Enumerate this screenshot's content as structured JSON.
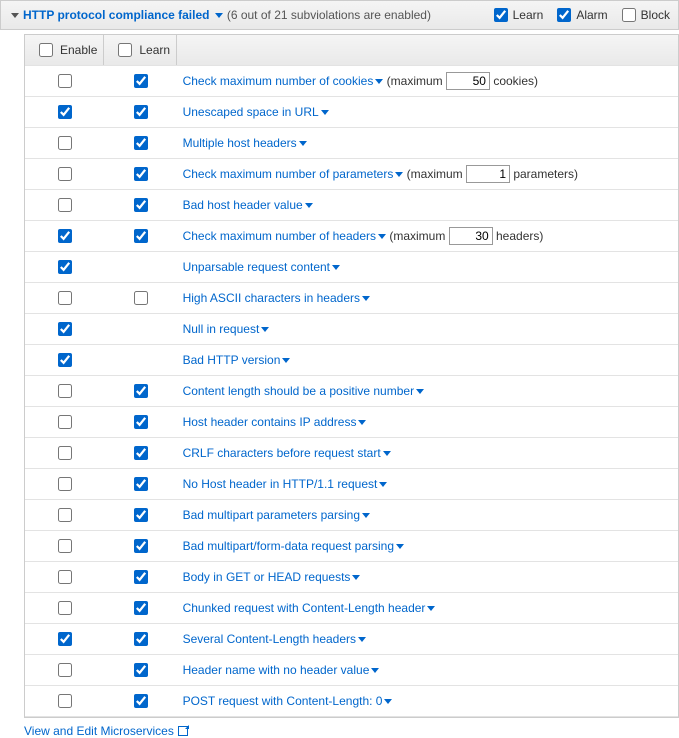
{
  "header": {
    "title": "HTTP protocol compliance failed",
    "subtitle": "(6 out of 21 subviolations are enabled)",
    "controls": {
      "learn": {
        "label": "Learn",
        "checked": true
      },
      "alarm": {
        "label": "Alarm",
        "checked": true
      },
      "block": {
        "label": "Block",
        "checked": false
      }
    }
  },
  "columns": {
    "enable": "Enable",
    "learn": "Learn"
  },
  "rows": [
    {
      "enable": false,
      "learn": true,
      "label": "Check maximum number of cookies",
      "dropdown": true,
      "extra": {
        "prefix": " (maximum ",
        "value": "50",
        "suffix": " cookies)"
      }
    },
    {
      "enable": true,
      "learn": true,
      "label": "Unescaped space in URL",
      "dropdown": true
    },
    {
      "enable": false,
      "learn": true,
      "label": "Multiple host headers",
      "dropdown": true
    },
    {
      "enable": false,
      "learn": true,
      "label": "Check maximum number of parameters",
      "dropdown": true,
      "extra": {
        "prefix": " (maximum ",
        "value": "1",
        "suffix": " parameters)"
      }
    },
    {
      "enable": false,
      "learn": true,
      "label": "Bad host header value",
      "dropdown": true
    },
    {
      "enable": true,
      "learn": true,
      "label": "Check maximum number of headers",
      "dropdown": true,
      "extra": {
        "prefix": " (maximum ",
        "value": "30",
        "suffix": " headers)"
      }
    },
    {
      "enable": true,
      "learn": null,
      "label": "Unparsable request content",
      "dropdown": true
    },
    {
      "enable": false,
      "learn": false,
      "label": "High ASCII characters in headers",
      "dropdown": true
    },
    {
      "enable": true,
      "learn": null,
      "label": "Null in request",
      "dropdown": true
    },
    {
      "enable": true,
      "learn": null,
      "label": "Bad HTTP version",
      "dropdown": true
    },
    {
      "enable": false,
      "learn": true,
      "label": "Content length should be a positive number",
      "dropdown": true
    },
    {
      "enable": false,
      "learn": true,
      "label": "Host header contains IP address",
      "dropdown": true
    },
    {
      "enable": false,
      "learn": true,
      "label": "CRLF characters before request start",
      "dropdown": true
    },
    {
      "enable": false,
      "learn": true,
      "label": "No Host header in HTTP/1.1 request",
      "dropdown": true
    },
    {
      "enable": false,
      "learn": true,
      "label": "Bad multipart parameters parsing",
      "dropdown": true
    },
    {
      "enable": false,
      "learn": true,
      "label": "Bad multipart/form-data request parsing",
      "dropdown": true
    },
    {
      "enable": false,
      "learn": true,
      "label": "Body in GET or HEAD requests",
      "dropdown": true
    },
    {
      "enable": false,
      "learn": true,
      "label": "Chunked request with Content-Length header",
      "dropdown": true
    },
    {
      "enable": true,
      "learn": true,
      "label": "Several Content-Length headers",
      "dropdown": true
    },
    {
      "enable": false,
      "learn": true,
      "label": "Header name with no header value",
      "dropdown": true
    },
    {
      "enable": false,
      "learn": true,
      "label": "POST request with Content-Length: 0",
      "dropdown": true
    }
  ],
  "footer": {
    "link": "View and Edit Microservices"
  }
}
